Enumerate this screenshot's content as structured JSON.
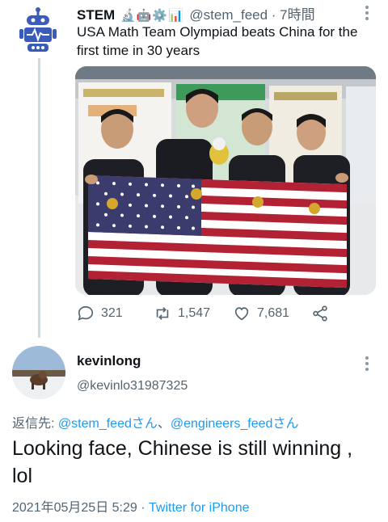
{
  "tweet": {
    "name": "STEM",
    "name_emoji": "🔬🤖⚙️📊",
    "handle": "@stem_feed",
    "time": "· 7時間",
    "text": "USA Math Team Olympiad beats China for the first time in 30 years",
    "stats": {
      "replies": "321",
      "retweets": "1,547",
      "likes": "7,681"
    }
  },
  "reply": {
    "name": "kevinlong",
    "handle": "@kevinlo31987325",
    "replying_prefix": "返信先: ",
    "replying_to_1": "@stem_feedさん",
    "replying_sep": "、",
    "replying_to_2": "@engineers_feedさん",
    "text": "Looking face, Chinese is still winning , lol",
    "date": "2021年05月25日 5:29",
    "dot": " · ",
    "source": "Twitter for iPhone"
  },
  "colors": {
    "accent": "#1d9bf0",
    "muted": "#536471",
    "text": "#0f1419"
  }
}
